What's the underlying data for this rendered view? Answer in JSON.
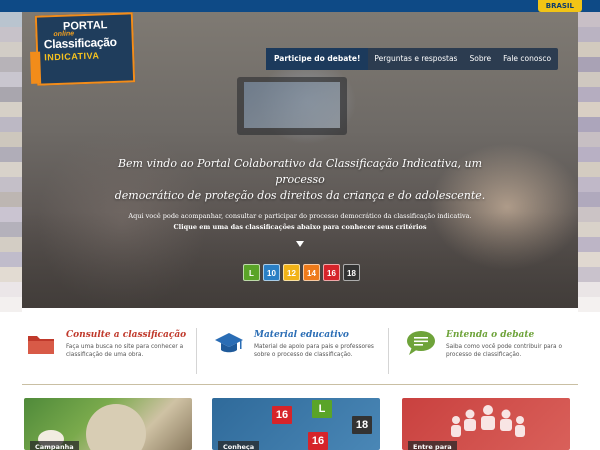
{
  "gov_bar": {
    "label": "BRASIL"
  },
  "logo": {
    "portal": "PORTAL",
    "online": "online",
    "classificacao": "Classificação",
    "indicativa": "INDICATIVA"
  },
  "nav": {
    "items": [
      {
        "label": "Participe do debate!",
        "active": true
      },
      {
        "label": "Perguntas e respostas",
        "active": false
      },
      {
        "label": "Sobre",
        "active": false
      },
      {
        "label": "Fale conosco",
        "active": false
      }
    ]
  },
  "hero": {
    "welcome_line1": "Bem vindo ao Portal Colaborativo da Classificação Indicativa, um processo",
    "welcome_line2": "democrático de proteção dos direitos da criança e do adolescente.",
    "subtitle": "Aqui você pode acompanhar, consultar e participar do processo democrático da classificação indicativa.",
    "call_to_action": "Clique em uma das classificações abaixo para conhecer seus critérios"
  },
  "ratings": [
    {
      "label": "L",
      "color": "#5aa428"
    },
    {
      "label": "10",
      "color": "#2a7fc4"
    },
    {
      "label": "12",
      "color": "#f2b318"
    },
    {
      "label": "14",
      "color": "#ee7a1a"
    },
    {
      "label": "16",
      "color": "#d6242a"
    },
    {
      "label": "18",
      "color": "#333333"
    }
  ],
  "features": [
    {
      "title": "Consulte a classificação",
      "description": "Faça uma busca no site para conhecer a classificação de uma obra.",
      "icon": "folder-icon",
      "color": "#c0392b"
    },
    {
      "title": "Material educativo",
      "description": "Material de apoio para pais e professores sobre o processo de classificação.",
      "icon": "graduation-cap-icon",
      "color": "#2a6db5"
    },
    {
      "title": "Entenda o debate",
      "description": "Saiba como você pode contribuir para o processo de classificação.",
      "icon": "speech-bubble-icon",
      "color": "#6ea33a"
    }
  ],
  "cards": [
    {
      "label": "Campanha"
    },
    {
      "label": "Conheça"
    },
    {
      "label": "Entre para"
    }
  ],
  "cards_mini_ratings": [
    "16",
    "L",
    "16",
    "18"
  ]
}
